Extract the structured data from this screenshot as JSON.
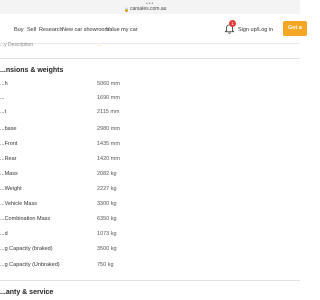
{
  "browser": {
    "url": "carsales.com.au"
  },
  "nav": {
    "items": [
      "Buy",
      "Sell",
      "Research",
      "New car showroom",
      "Value my car"
    ],
    "notification_count": "1",
    "signin": "Sign up/Log in",
    "cta": "Get a"
  },
  "cutoff_row": {
    "label": "...y Description",
    "value": "..."
  },
  "dimensions": {
    "title": "...nsions & weights",
    "rows": [
      {
        "label": "...h",
        "value": "5060 mm"
      },
      {
        "label": "...",
        "value": "1690 mm"
      },
      {
        "label": "...t",
        "value": "2115 mm"
      },
      {
        "label": "...base",
        "value": "2980 mm"
      },
      {
        "label": "...Front",
        "value": "1435 mm"
      },
      {
        "label": "...Rear",
        "value": "1420 mm"
      },
      {
        "label": "...Mass",
        "value": "2082 kg"
      },
      {
        "label": "...Weight",
        "value": "2227 kg"
      },
      {
        "label": "...Vehicle Mass",
        "value": "3300 kg"
      },
      {
        "label": "...Combination Mass",
        "value": "6350 kg"
      },
      {
        "label": "...d",
        "value": "1073 kg"
      },
      {
        "label": "...g Capacity (braked)",
        "value": "3500 kg"
      },
      {
        "label": "...g Capacity (Unbraked)",
        "value": "750 kg"
      }
    ]
  },
  "warranty": {
    "title": "...anty & service"
  }
}
